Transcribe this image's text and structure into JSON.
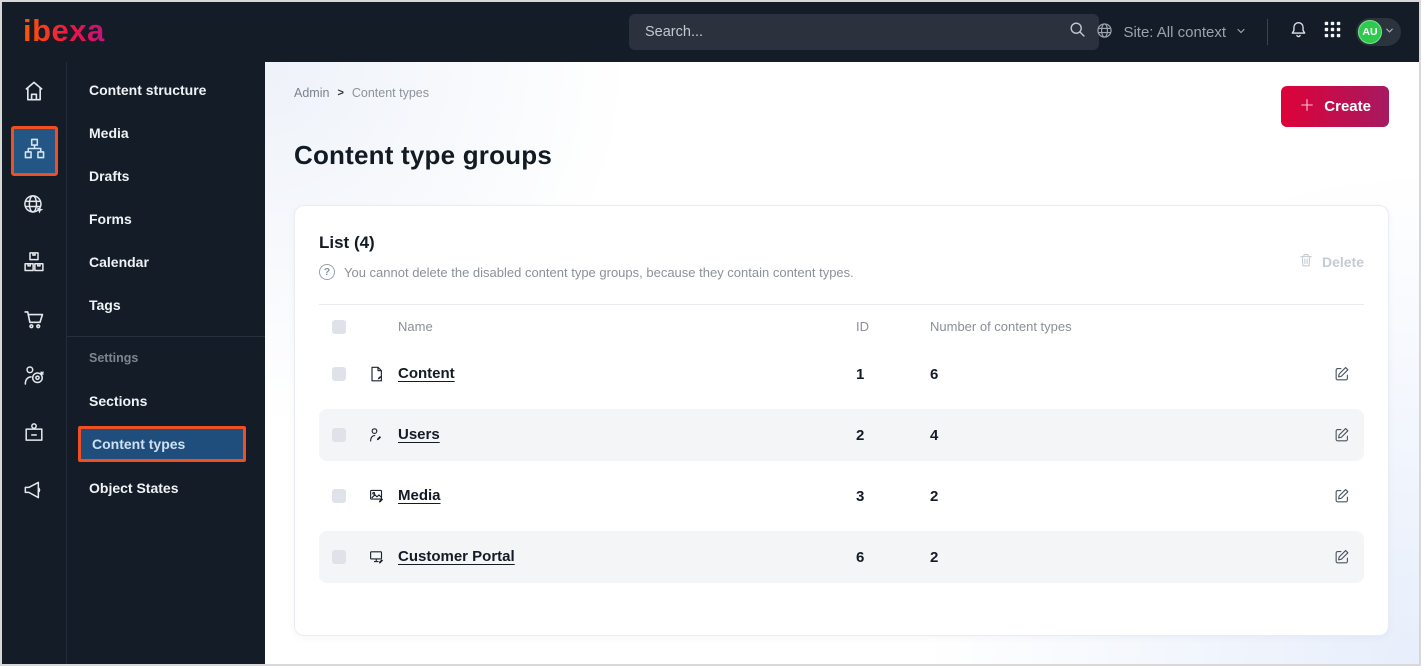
{
  "colors": {
    "topbar_bg": "#141c27",
    "annotation_orange": "#f04e23",
    "selected_blue": "#1f4e7d",
    "brand_gradient": [
      "#ff5a00",
      "#c0147c"
    ],
    "create_gradient": [
      "#dd0239",
      "#a61a60"
    ],
    "avatar_green": "#2fc94e",
    "text_dark": "#131b26",
    "text_muted": "#8a9097",
    "disabled_gray": "#c5cbd3",
    "row_stripe": "#f4f5f7"
  },
  "icons": {
    "help_glyph": "?"
  },
  "topbar": {
    "logo_text": "ibexa",
    "search_placeholder": "Search...",
    "site_context_label": "Site: All context",
    "avatar_initials": "AU"
  },
  "sidebar": {
    "main_items": [
      "Content structure",
      "Media",
      "Drafts",
      "Forms",
      "Calendar",
      "Tags"
    ],
    "section_label": "Settings",
    "settings_items": [
      "Sections",
      "Content types",
      "Object States"
    ],
    "active_item": "Content types"
  },
  "main": {
    "breadcrumb": {
      "items": [
        "Admin",
        "Content types"
      ],
      "separator": ">"
    },
    "create_button_label": "Create",
    "page_title": "Content type groups",
    "card": {
      "list_title": "List (4)",
      "help_text": "You cannot delete the disabled content type groups, because they contain content types.",
      "delete_button_label": "Delete",
      "table": {
        "columns": {
          "name": "Name",
          "id": "ID",
          "count": "Number of content types"
        },
        "rows": [
          {
            "name": "Content",
            "id": "1",
            "count": "6"
          },
          {
            "name": "Users",
            "id": "2",
            "count": "4"
          },
          {
            "name": "Media",
            "id": "3",
            "count": "2"
          },
          {
            "name": "Customer Portal",
            "id": "6",
            "count": "2"
          }
        ]
      }
    }
  }
}
